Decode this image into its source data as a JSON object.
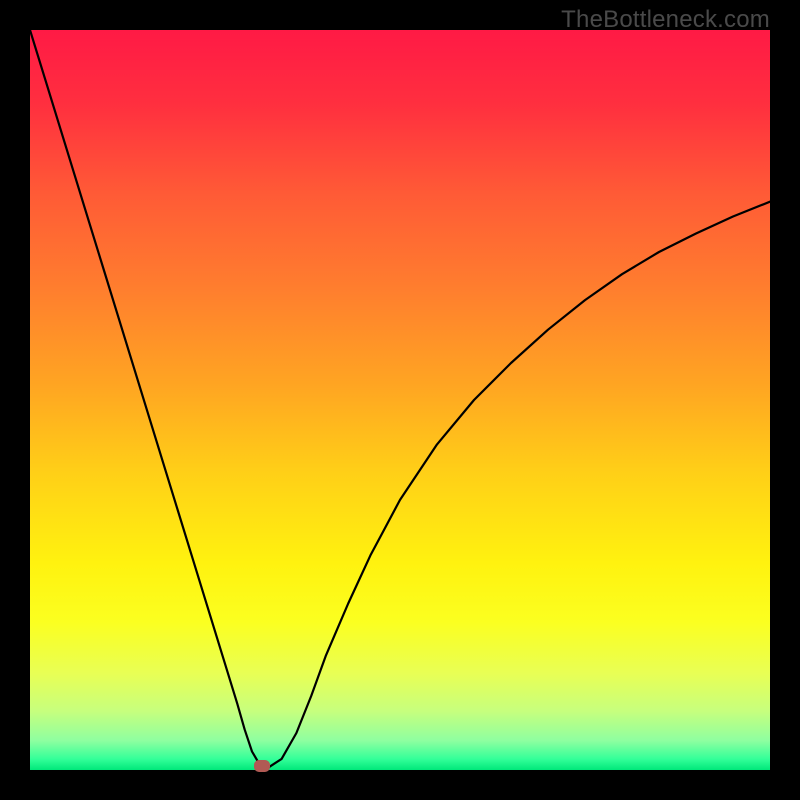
{
  "watermark": "TheBottleneck.com",
  "marker_color": "#b15a54",
  "gradient_stops": [
    {
      "offset": 0.0,
      "color": "#ff1a45"
    },
    {
      "offset": 0.1,
      "color": "#ff2f3f"
    },
    {
      "offset": 0.22,
      "color": "#ff5a36"
    },
    {
      "offset": 0.35,
      "color": "#ff7e2e"
    },
    {
      "offset": 0.48,
      "color": "#ffa522"
    },
    {
      "offset": 0.6,
      "color": "#ffd017"
    },
    {
      "offset": 0.72,
      "color": "#fff20f"
    },
    {
      "offset": 0.8,
      "color": "#fbff20"
    },
    {
      "offset": 0.87,
      "color": "#e8ff55"
    },
    {
      "offset": 0.92,
      "color": "#c7ff7d"
    },
    {
      "offset": 0.96,
      "color": "#8fffa0"
    },
    {
      "offset": 0.985,
      "color": "#34ff99"
    },
    {
      "offset": 1.0,
      "color": "#00e87a"
    }
  ],
  "chart_data": {
    "type": "line",
    "title": "",
    "xlabel": "",
    "ylabel": "",
    "xlim": [
      0,
      100
    ],
    "ylim": [
      0,
      100
    ],
    "x": [
      0,
      2,
      4,
      6,
      8,
      10,
      12,
      14,
      16,
      18,
      20,
      22,
      24,
      26,
      28,
      29,
      30,
      31,
      32,
      34,
      36,
      38,
      40,
      43,
      46,
      50,
      55,
      60,
      65,
      70,
      75,
      80,
      85,
      90,
      95,
      100
    ],
    "values": [
      100,
      93.5,
      87,
      80.5,
      74,
      67.5,
      61,
      54.5,
      48,
      41.5,
      35,
      28.5,
      22,
      15.5,
      9,
      5.5,
      2.5,
      0.8,
      0.2,
      1.5,
      5,
      10,
      15.5,
      22.5,
      29,
      36.5,
      44,
      50,
      55,
      59.5,
      63.5,
      67,
      70,
      72.5,
      74.8,
      76.8
    ],
    "marker": {
      "x": 31.3,
      "y": 0.5
    },
    "grid": false,
    "legend": false
  }
}
